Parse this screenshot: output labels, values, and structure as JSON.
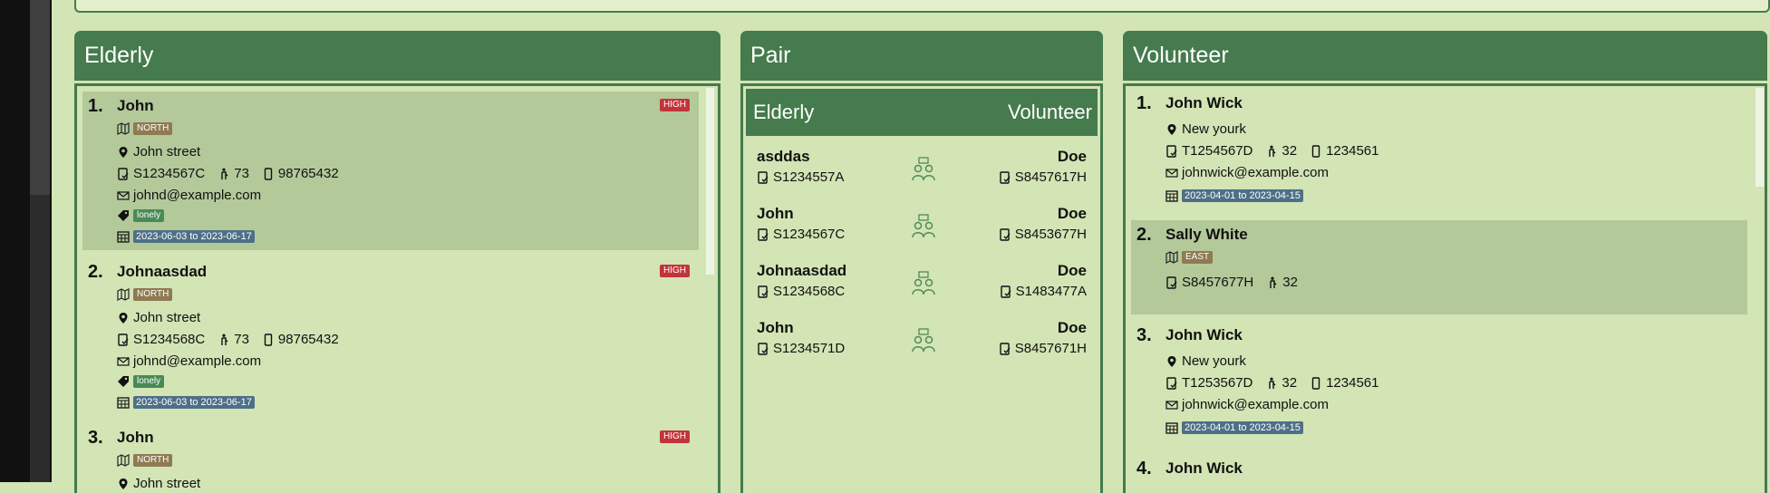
{
  "top_panel": {},
  "elderly_panel": {
    "title": "Elderly",
    "items": [
      {
        "index": "1.",
        "name": "John",
        "risk": "HIGH",
        "region": "NORTH",
        "address": "John street",
        "nric": "S1234567C",
        "age": "73",
        "phone": "98765432",
        "email": "johnd@example.com",
        "tag": "lonely",
        "date_range": "2023-06-03 to 2023-06-17"
      },
      {
        "index": "2.",
        "name": "Johnaasdad",
        "risk": "HIGH",
        "region": "NORTH",
        "address": "John street",
        "nric": "S1234568C",
        "age": "73",
        "phone": "98765432",
        "email": "johnd@example.com",
        "tag": "lonely",
        "date_range": "2023-06-03 to 2023-06-17"
      },
      {
        "index": "3.",
        "name": "John",
        "risk": "HIGH",
        "region": "NORTH",
        "address": "John street"
      }
    ]
  },
  "pair_panel": {
    "title": "Pair",
    "col_elderly": "Elderly",
    "col_volunteer": "Volunteer",
    "rows": [
      {
        "elderly_name": "asddas",
        "elderly_nric": "S1234557A",
        "volunteer_name": "Doe",
        "volunteer_nric": "S8457617H"
      },
      {
        "elderly_name": "John",
        "elderly_nric": "S1234567C",
        "volunteer_name": "Doe",
        "volunteer_nric": "S8453677H"
      },
      {
        "elderly_name": "Johnaasdad",
        "elderly_nric": "S1234568C",
        "volunteer_name": "Doe",
        "volunteer_nric": "S1483477A"
      },
      {
        "elderly_name": "John",
        "elderly_nric": "S1234571D",
        "volunteer_name": "Doe",
        "volunteer_nric": "S8457671H"
      }
    ]
  },
  "volunteer_panel": {
    "title": "Volunteer",
    "items": [
      {
        "index": "1.",
        "name": "John Wick",
        "address": "New yourk",
        "nric": "T1254567D",
        "age": "32",
        "phone": "1234561",
        "email": "johnwick@example.com",
        "date_range": "2023-04-01 to 2023-04-15"
      },
      {
        "index": "2.",
        "name": "Sally White",
        "region": "EAST",
        "nric": "S8457677H",
        "age": "32"
      },
      {
        "index": "3.",
        "name": "John Wick",
        "address": "New yourk",
        "nric": "T1253567D",
        "age": "32",
        "phone": "1234561",
        "email": "johnwick@example.com",
        "date_range": "2023-04-01 to 2023-04-15"
      },
      {
        "index": "4.",
        "name": "John Wick"
      }
    ]
  },
  "colors": {
    "header": "#457b4d",
    "background": "#d3e4b5",
    "selected": "#b3c99a",
    "high": "#c2343a",
    "region": "#8f7a52",
    "lonely": "#478b56",
    "date": "#4d6f87"
  }
}
